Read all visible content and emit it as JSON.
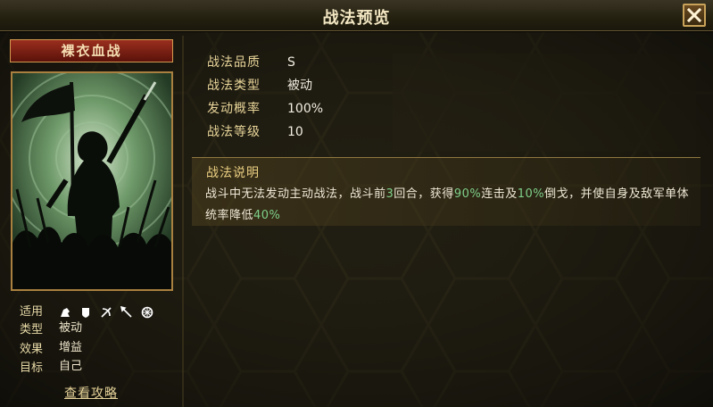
{
  "window": {
    "title": "战法预览",
    "close_icon": "close-icon"
  },
  "card": {
    "name": "裸衣血战",
    "art_description_icon": "warrior-banner-art"
  },
  "left_info": {
    "applicable_label": "适用",
    "applicable_icons": [
      "cavalry-icon",
      "shield-icon",
      "bow-icon",
      "spear-icon",
      "wheel-icon"
    ],
    "type_label": "类型",
    "type_value": "被动",
    "effect_label": "效果",
    "effect_value": "增益",
    "target_label": "目标",
    "target_value": "自己",
    "guide_link": "查看攻略"
  },
  "attributes": [
    {
      "key": "战法品质",
      "value": "S"
    },
    {
      "key": "战法类型",
      "value": "被动"
    },
    {
      "key": "发动概率",
      "value": "100%"
    },
    {
      "key": "战法等级",
      "value": "10"
    }
  ],
  "description": {
    "title": "战法说明",
    "part1": "战斗中无法发动主动战法，战斗前",
    "num1": "3",
    "part2": "回合，获得",
    "num2": "90%",
    "part3": "连击及",
    "num3": "10%",
    "part4": "倒戈，并使自身及敌军单体统率降低",
    "num4": "40%"
  },
  "colors": {
    "highlight": "#7fd08a",
    "title_bar": "#2a2514",
    "card_title": "#8a2818"
  }
}
